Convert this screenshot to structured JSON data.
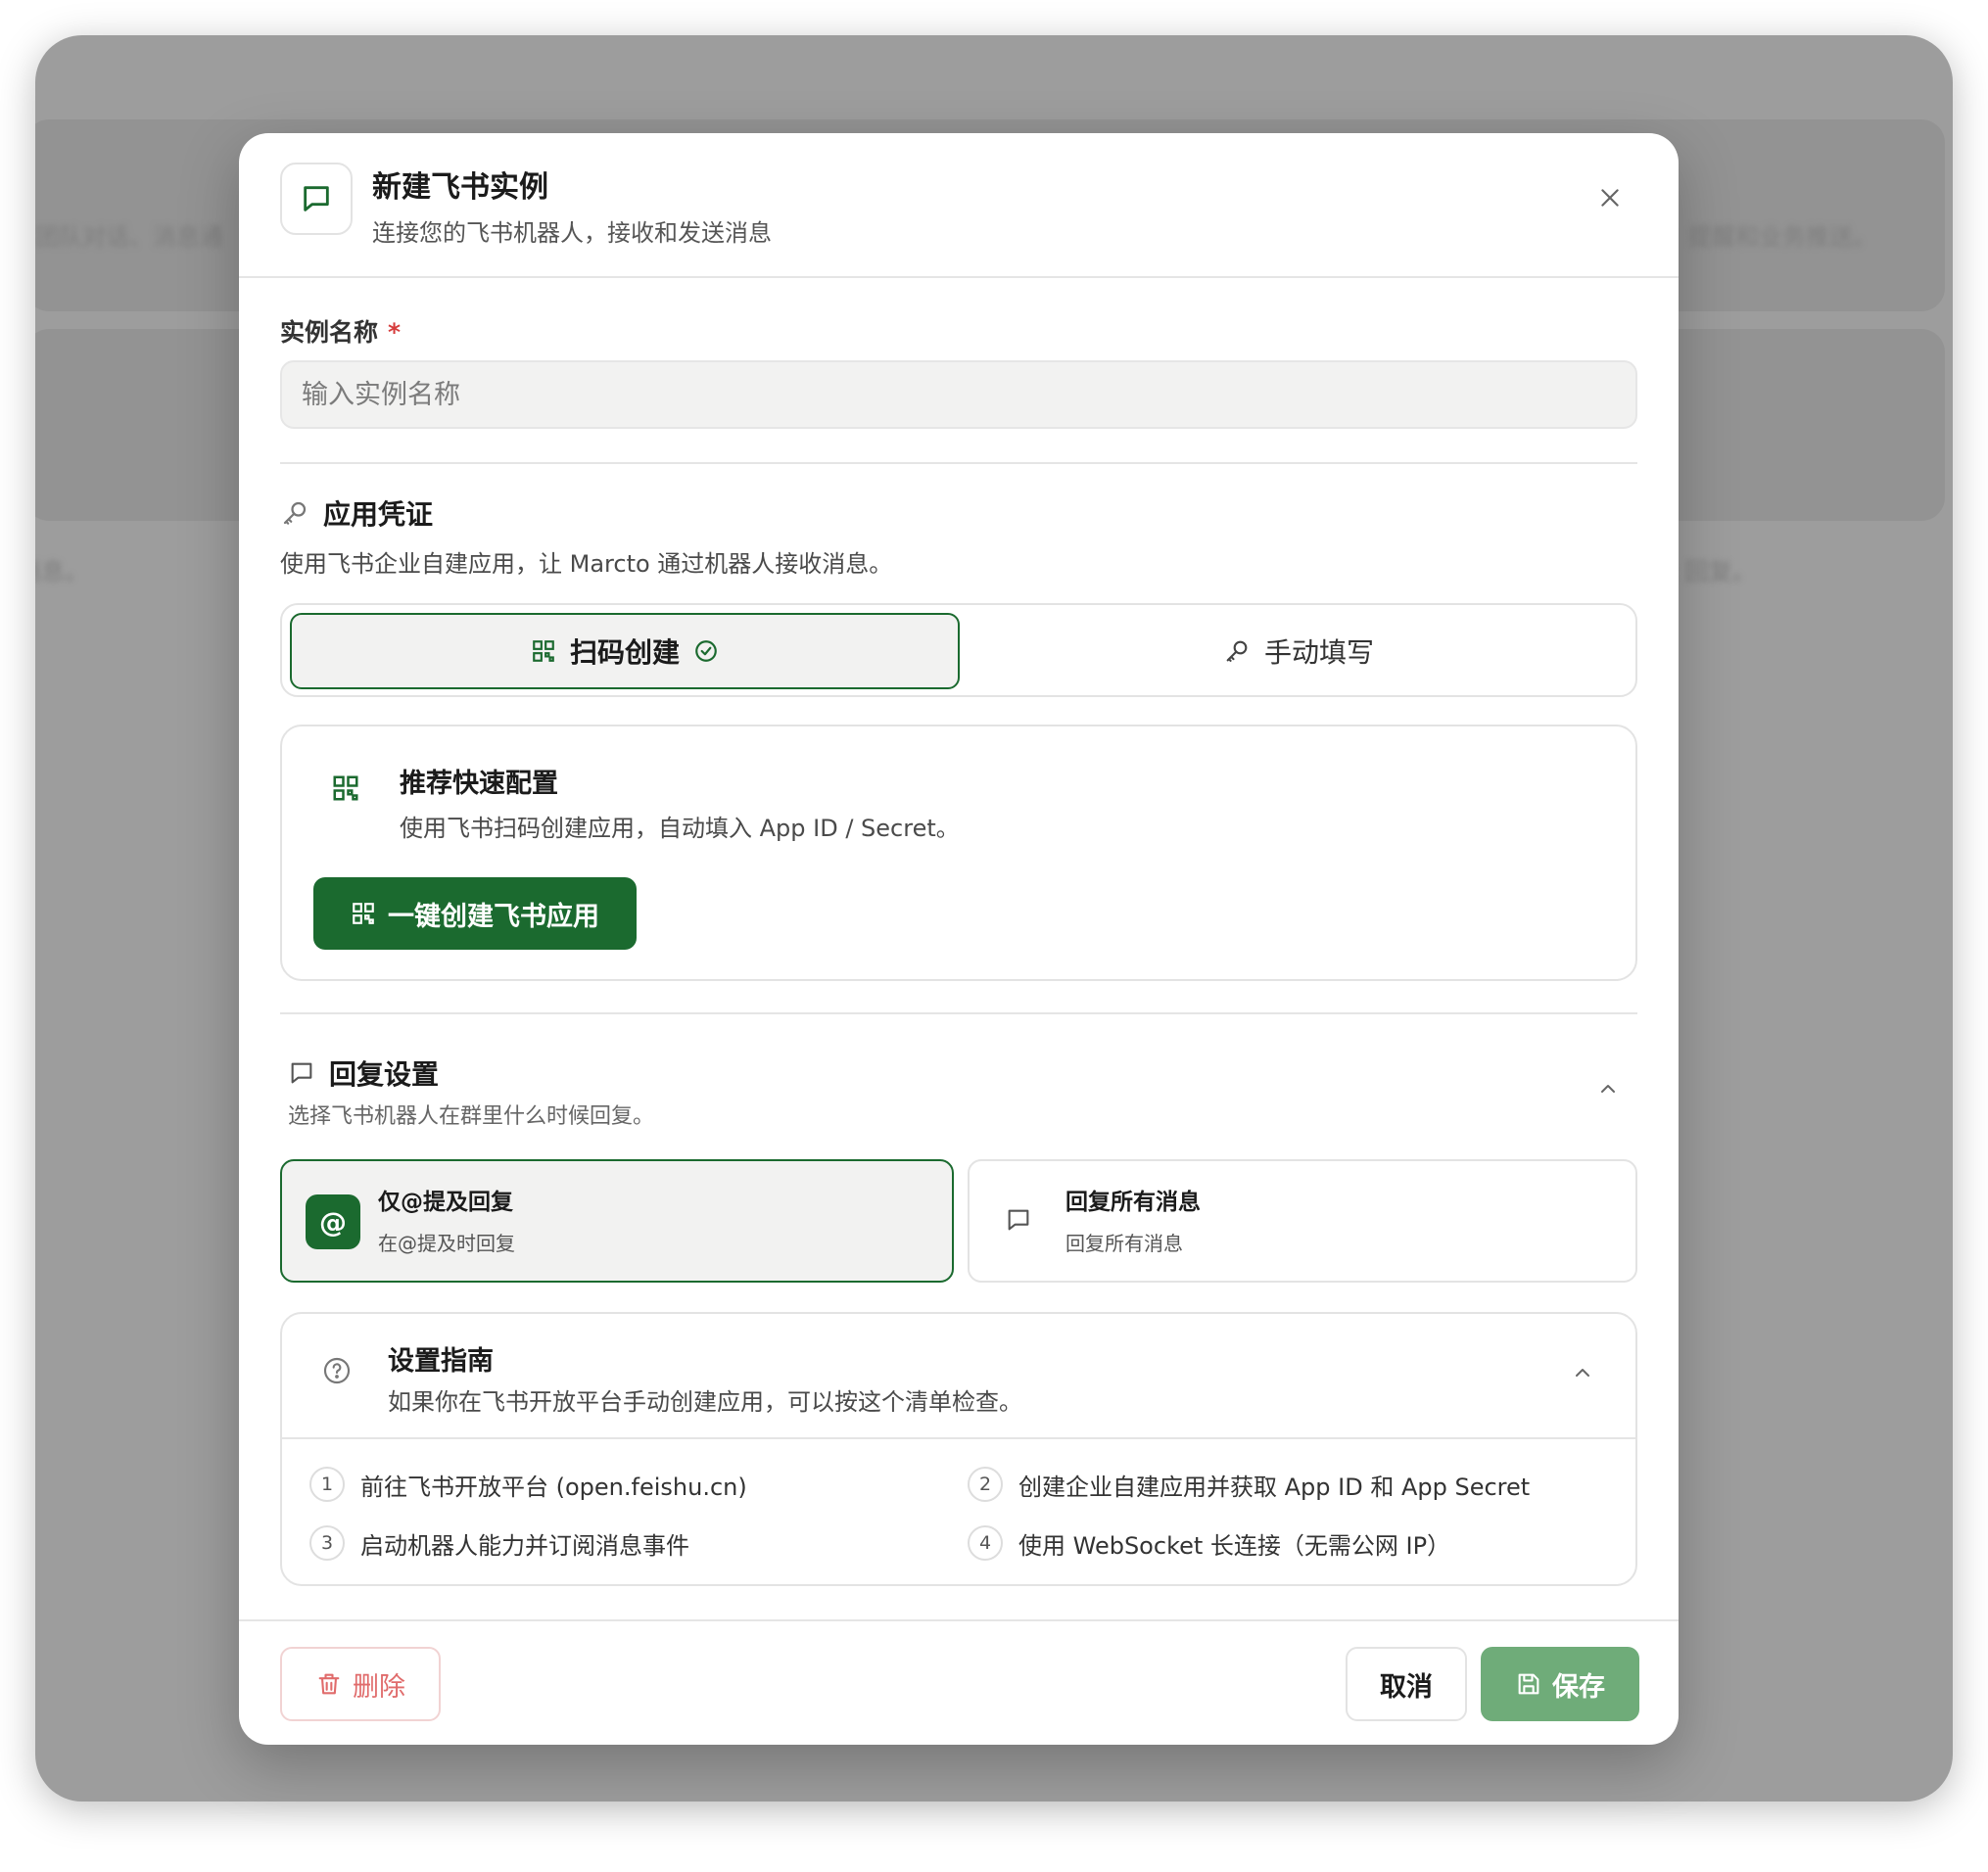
{
  "background": {
    "blurred_left_1": "团队对话、消息通",
    "blurred_right_1": "、提醒和业务推送。",
    "blurred_left_2": "消息。",
    "blurred_right_2": "ket 回复。"
  },
  "dialog": {
    "title": "新建飞书实例",
    "subtitle": "连接您的飞书机器人，接收和发送消息",
    "close_icon": "close-icon",
    "accent_color": "#1b6a2f"
  },
  "instance_name": {
    "label": "实例名称",
    "required_mark": "*",
    "placeholder": "输入实例名称",
    "value": ""
  },
  "credentials": {
    "title": "应用凭证",
    "description": "使用飞书企业自建应用，让 Marcto 通过机器人接收消息。",
    "tabs": [
      {
        "label": "扫码创建",
        "icon": "qr-code-icon",
        "active": true
      },
      {
        "label": "手动填写",
        "icon": "key-icon",
        "active": false
      }
    ],
    "quick": {
      "title": "推荐快速配置",
      "description": "使用飞书扫码创建应用，自动填入 App ID / Secret。",
      "button_label": "一键创建飞书应用"
    }
  },
  "reply": {
    "title": "回复设置",
    "description": "选择飞书机器人在群里什么时候回复。",
    "options": [
      {
        "badge": "@",
        "title": "仅@提及回复",
        "subtitle": "在@提及时回复",
        "selected": true
      },
      {
        "title": "回复所有消息",
        "subtitle": "回复所有消息",
        "selected": false
      }
    ]
  },
  "guide": {
    "title": "设置指南",
    "description": "如果你在飞书开放平台手动创建应用，可以按这个清单检查。",
    "steps": [
      {
        "num": "1",
        "text": "前往飞书开放平台 (open.feishu.cn)"
      },
      {
        "num": "2",
        "text": "创建企业自建应用并获取 App ID 和 App Secret"
      },
      {
        "num": "3",
        "text": "启动机器人能力并订阅消息事件"
      },
      {
        "num": "4",
        "text": "使用 WebSocket 长连接（无需公网 IP）"
      }
    ]
  },
  "footer": {
    "delete_label": "删除",
    "cancel_label": "取消",
    "save_label": "保存",
    "delete_color": "#e06b6b",
    "save_color": "#6fac79"
  }
}
